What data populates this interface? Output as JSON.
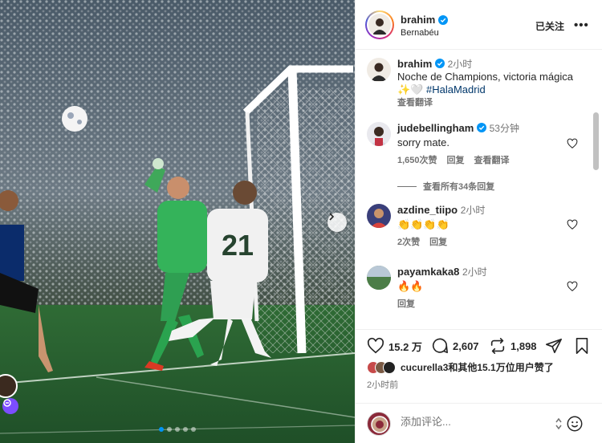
{
  "post": {
    "author": "brahim",
    "location": "Bernabéu",
    "follow_label": "已关注",
    "more_label": "•••",
    "image_carousel": {
      "slides": 5,
      "active": 0
    }
  },
  "caption": {
    "user": "brahim",
    "time": "2小时",
    "text": "Noche de Champions, victoria mágica ✨🤍 ",
    "hashtag": "#HalaMadrid",
    "translate": "查看翻译"
  },
  "comments": [
    {
      "user": "judebellingham",
      "verified": true,
      "time": "53分钟",
      "text": "sorry mate.",
      "likes": "1,650次赞",
      "reply": "回复",
      "translate": "查看翻译",
      "view_replies": "查看所有34条回复"
    },
    {
      "user": "azdine_tiipo",
      "verified": false,
      "time": "2小时",
      "text": "👏👏👏👏",
      "likes": "2次赞",
      "reply": "回复"
    },
    {
      "user": "payamkaka8",
      "verified": false,
      "time": "2小时",
      "text": "🔥🔥",
      "reply": "回复"
    }
  ],
  "actions": {
    "likes": "15.2 万",
    "comments": "2,607",
    "reposts": "1,898"
  },
  "liked_by": "cucurella3和其他15.1万位用户赞了",
  "posted_ago": "2小时前",
  "composer": {
    "placeholder": "添加评论..."
  },
  "colors": {
    "accent": "#0095f6",
    "verified": "#0095f6",
    "hashtag": "#00376b",
    "muted": "#737373"
  }
}
